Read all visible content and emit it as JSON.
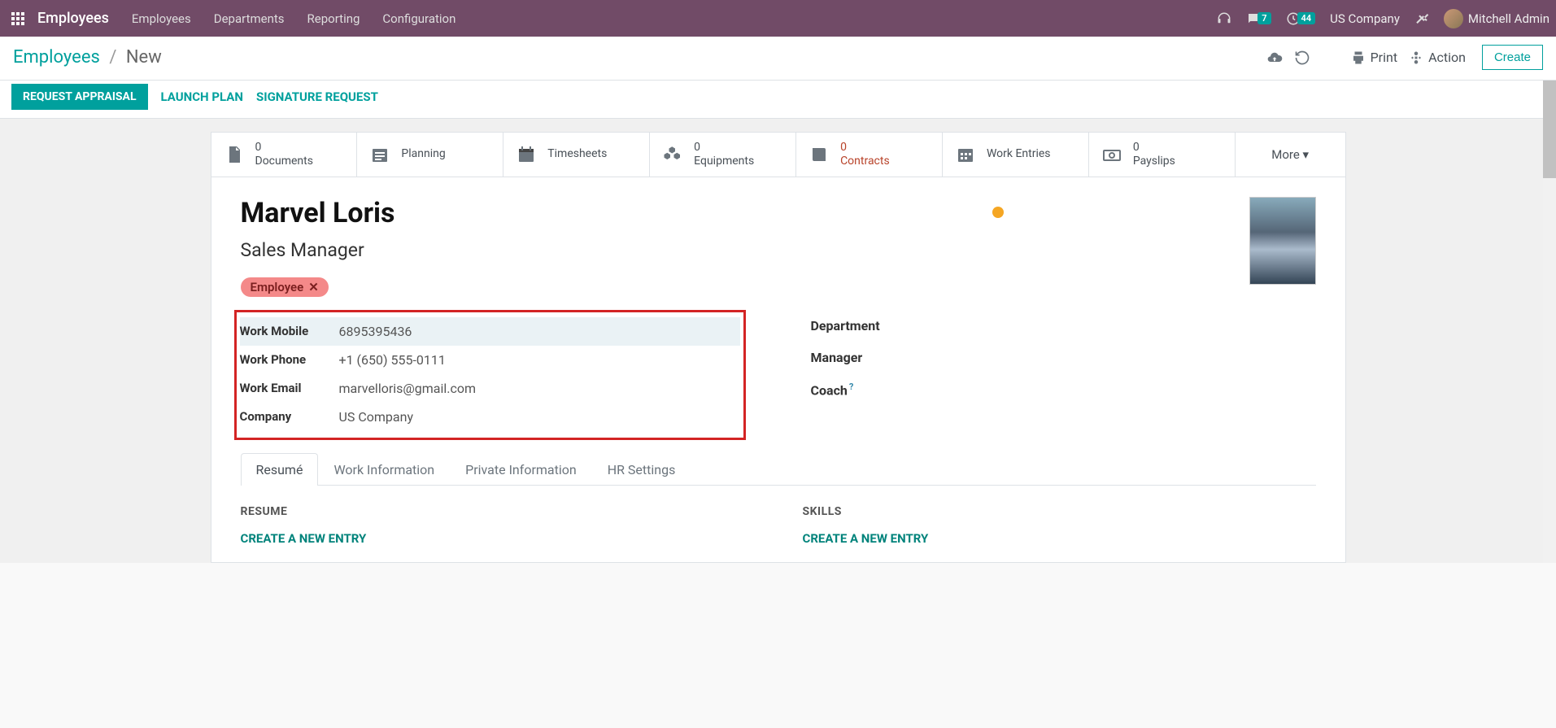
{
  "topbar": {
    "app_title": "Employees",
    "nav": [
      "Employees",
      "Departments",
      "Reporting",
      "Configuration"
    ],
    "msg_badge": "7",
    "activity_badge": "44",
    "company": "US Company",
    "user": "Mitchell Admin"
  },
  "breadcrumb": {
    "root": "Employees",
    "current": "New"
  },
  "cp_buttons": {
    "print": "Print",
    "action": "Action",
    "create": "Create"
  },
  "status_buttons": {
    "primary": "REQUEST APPRAISAL",
    "launch": "LAUNCH PLAN",
    "signature": "SIGNATURE REQUEST"
  },
  "stat_buttons": [
    {
      "icon": "doc",
      "value": "0",
      "label": "Documents"
    },
    {
      "icon": "cal-lines",
      "value": "",
      "label": "Planning"
    },
    {
      "icon": "calendar",
      "value": "",
      "label": "Timesheets"
    },
    {
      "icon": "cubes",
      "value": "0",
      "label": "Equipments"
    },
    {
      "icon": "book",
      "value": "0",
      "label": "Contracts",
      "warn": true
    },
    {
      "icon": "cal-grid",
      "value": "",
      "label": "Work Entries"
    },
    {
      "icon": "money",
      "value": "0",
      "label": "Payslips"
    }
  ],
  "more_label": "More",
  "employee": {
    "name": "Marvel Loris",
    "title": "Sales Manager",
    "tag": "Employee",
    "fields": {
      "work_mobile_label": "Work Mobile",
      "work_mobile": "6895395436",
      "work_phone_label": "Work Phone",
      "work_phone": "+1 (650) 555-0111",
      "work_email_label": "Work Email",
      "work_email": "marvelloris@gmail.com",
      "company_label": "Company",
      "company": "US Company"
    },
    "fields2": {
      "department_label": "Department",
      "manager_label": "Manager",
      "coach_label": "Coach"
    }
  },
  "tabs": [
    "Resumé",
    "Work Information",
    "Private Information",
    "HR Settings"
  ],
  "tab_content": {
    "resume_heading": "RESUME",
    "skills_heading": "SKILLS",
    "create_entry": "CREATE A NEW ENTRY"
  }
}
